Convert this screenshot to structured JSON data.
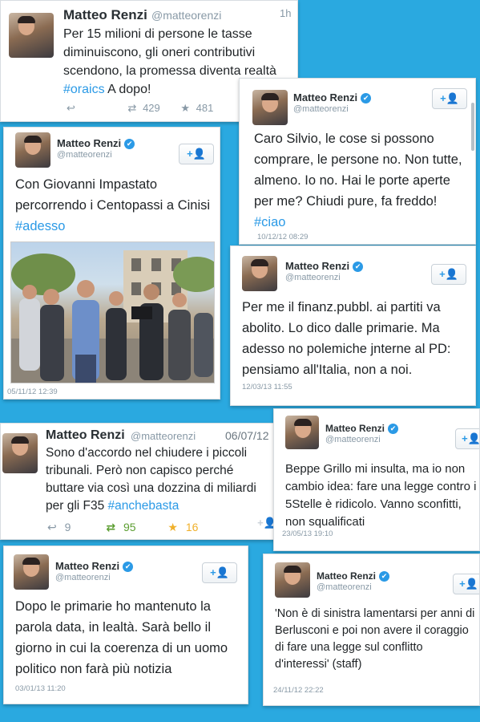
{
  "author": {
    "name": "Matteo Renzi",
    "handle": "@matteorenzi"
  },
  "follow_label": "+👤",
  "tweets": [
    {
      "time": "1h",
      "text": "Per 15 milioni di persone le tasse diminuiscono, gli oneri contributivi scendono, la promessa diventa realtà #oraics A dopo!",
      "retweets": "429",
      "favorites": "481"
    },
    {
      "text_a": "Caro Silvio, le cose si possono comprare, le persone no. Non tutte, almeno. Io no. Hai le porte aperte per me? Chiudi pure, fa freddo!",
      "hashtag": "#ciao",
      "date": "10/12/12 08:29"
    },
    {
      "text_a": "Con Giovanni Impastato percorrendo i Centopassi a Cinisi",
      "hashtag": "#adesso",
      "date": "05/11/12 12:39"
    },
    {
      "text": "Per me il finanz.pubbl. ai partiti va abolito. Lo dico dalle primarie. Ma adesso no polemiche jnterne al PD: pensiamo all'Italia, non a noi.",
      "date": "12/03/13 11:55"
    },
    {
      "time": "06/07/12",
      "text": "Sono d'accordo nel chiudere i piccoli tribunali. Però non capisco perché buttare via così una dozzina di miliardi per gli F35 #anchebasta",
      "replies": "9",
      "retweets": "95",
      "favorites": "16"
    },
    {
      "text": "Beppe Grillo mi insulta, ma io non cambio idea: fare una legge contro i 5Stelle è ridicolo. Vanno sconfitti, non squalificati",
      "date": "23/05/13 19:10"
    },
    {
      "text": "Dopo le primarie ho mantenuto la parola data, in lealtà. Sarà bello il giorno in cui la coerenza di un uomo politico non farà più notizia",
      "date": "03/01/13 11:20"
    },
    {
      "text": "'Non è di sinistra lamentarsi per anni di Berlusconi e poi non avere il coraggio di fare una legge sul conflitto d'interessi' (staff)",
      "date": "24/11/12 22:22"
    }
  ],
  "icons": {
    "reply": "reply-icon",
    "retweet": "retweet-icon",
    "favorite": "star-icon",
    "follow": "follow-button-icon"
  },
  "colors": {
    "background": "#2aa9e0",
    "link": "#2b9ae6",
    "retweet_active": "#5c9e31",
    "favorite_active": "#f0b02a"
  }
}
